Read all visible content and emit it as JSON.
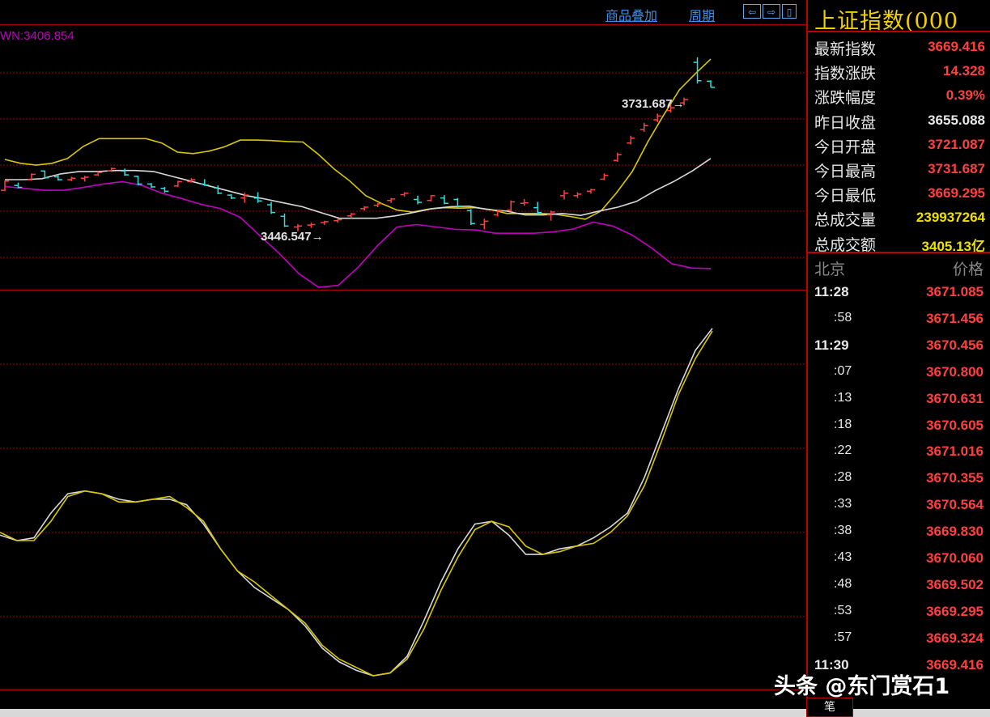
{
  "toolbar": {
    "overlay_label": "商品叠加",
    "period_label": "周期",
    "nav": [
      "⇦",
      "⇨",
      "▯"
    ]
  },
  "chart": {
    "bollinger_dn_label": "WN:3406.854",
    "high_annotation": "3731.687",
    "low_annotation": "3446.547",
    "colors": {
      "up": "#ff4040",
      "down": "#30e0e0",
      "upper_band": "#d8c800",
      "mid_band": "#d8d8d8",
      "lower_band": "#c000c0",
      "grid": "#a00000"
    }
  },
  "chart_data": [
    {
      "type": "candlestick",
      "candles": [
        [
          3456.0,
          3476.0,
          3454.0,
          3475.0
        ],
        [
          3466.0,
          3472.0,
          3460.0,
          3462.0
        ],
        [
          3478.0,
          3491.0,
          3476.0,
          3489.0
        ],
        [
          3496.0,
          3497.0,
          3480.0,
          3482.0
        ],
        [
          3484.0,
          3489.0,
          3476.0,
          3478.0
        ],
        [
          3478.0,
          3484.0,
          3475.0,
          3481.0
        ],
        [
          3481.0,
          3486.0,
          3474.0,
          3483.0
        ],
        [
          3488.0,
          3495.0,
          3486.0,
          3493.0
        ],
        [
          3496.0,
          3503.0,
          3494.0,
          3501.0
        ],
        [
          3496.0,
          3501.0,
          3486.0,
          3488.0
        ],
        [
          3485.0,
          3486.0,
          3466.0,
          3469.0
        ],
        [
          3469.0,
          3471.0,
          3461.0,
          3463.0
        ],
        [
          3460.0,
          3463.0,
          3451.0,
          3454.0
        ],
        [
          3465.0,
          3476.0,
          3463.0,
          3474.0
        ],
        [
          3474.0,
          3481.0,
          3472.0,
          3478.0
        ],
        [
          3469.0,
          3479.0,
          3465.0,
          3467.0
        ],
        [
          3461.0,
          3466.0,
          3448.0,
          3450.0
        ],
        [
          3446.0,
          3448.0,
          3438.0,
          3440.0
        ],
        [
          3440.0,
          3451.0,
          3430.0,
          3446.0
        ],
        [
          3440.0,
          3452.0,
          3430.0,
          3434.0
        ],
        [
          3426.0,
          3432.0,
          3407.0,
          3410.0
        ],
        [
          3402.0,
          3408.0,
          3380.0,
          3382.0
        ],
        [
          3380.0,
          3386.0,
          3371.0,
          3382.0
        ],
        [
          3384.0,
          3389.0,
          3378.0,
          3385.0
        ],
        [
          3389.0,
          3393.0,
          3384.0,
          3391.0
        ],
        [
          3393.0,
          3397.0,
          3389.0,
          3395.0
        ],
        [
          3403.0,
          3409.0,
          3398.0,
          3407.0
        ],
        [
          3418.0,
          3423.0,
          3414.0,
          3421.0
        ],
        [
          3425.0,
          3430.0,
          3421.0,
          3428.0
        ],
        [
          3435.0,
          3440.0,
          3430.0,
          3438.0
        ],
        [
          3447.0,
          3452.0,
          3443.0,
          3450.0
        ],
        [
          3437.0,
          3445.0,
          3427.0,
          3431.0
        ],
        [
          3435.0,
          3446.0,
          3433.0,
          3445.0
        ],
        [
          3440.0,
          3446.0,
          3427.0,
          3429.0
        ],
        [
          3437.0,
          3440.0,
          3420.0,
          3423.0
        ],
        [
          3414.0,
          3417.0,
          3384.0,
          3387.0
        ],
        [
          3385.0,
          3397.0,
          3375.0,
          3392.0
        ],
        [
          3405.0,
          3415.0,
          3402.0,
          3413.0
        ],
        [
          3415.0,
          3435.0,
          3412.0,
          3432.0
        ],
        [
          3429.0,
          3438.0,
          3424.0,
          3430.0
        ],
        [
          3420.0,
          3432.0,
          3405.0,
          3410.0
        ],
        [
          3405.0,
          3414.0,
          3393.0,
          3411.0
        ],
        [
          3445.0,
          3456.0,
          3437.0,
          3450.0
        ],
        [
          3445.0,
          3452.0,
          3440.0,
          3448.0
        ],
        [
          3454.0,
          3459.0,
          3449.0,
          3457.0
        ],
        [
          3479.0,
          3491.0,
          3477.0,
          3487.0
        ],
        [
          3518.0,
          3534.0,
          3515.0,
          3530.0
        ],
        [
          3554.0,
          3569.0,
          3551.0,
          3564.0
        ],
        [
          3582.0,
          3596.0,
          3577.0,
          3590.0
        ],
        [
          3602.0,
          3615.0,
          3597.0,
          3610.0
        ],
        [
          3621.0,
          3633.0,
          3617.0,
          3627.0
        ],
        [
          3637.0,
          3648.0,
          3632.0,
          3644.0
        ],
        [
          3721.087,
          3731.687,
          3677.0,
          3683.0
        ],
        [
          3682.0,
          3684.0,
          3669.295,
          3669.416
        ]
      ],
      "boll_upper": [
        3520,
        3512,
        3508,
        3512,
        3522,
        3547,
        3563,
        3563,
        3563,
        3563,
        3554,
        3535,
        3532,
        3537,
        3546,
        3560,
        3560,
        3559,
        3557,
        3556,
        3530,
        3500,
        3475,
        3445,
        3429,
        3415,
        3411,
        3417,
        3420,
        3419,
        3420,
        3416,
        3408,
        3408,
        3408,
        3407,
        3402,
        3396,
        3413,
        3451,
        3495,
        3557,
        3612,
        3664,
        3697,
        3728
      ],
      "boll_mid": [
        3478,
        3478,
        3480,
        3490,
        3495,
        3495,
        3497,
        3497,
        3495,
        3485,
        3475,
        3465,
        3455,
        3445,
        3438,
        3430,
        3422,
        3410,
        3398,
        3398,
        3398,
        3403,
        3410,
        3418,
        3422,
        3423,
        3416,
        3413,
        3405,
        3405,
        3408,
        3404,
        3413,
        3421,
        3433,
        3455,
        3474,
        3496,
        3522
      ],
      "boll_lower": [
        3464,
        3460,
        3456,
        3456,
        3462,
        3469,
        3474,
        3466,
        3450,
        3439,
        3427,
        3418,
        3400,
        3362,
        3325,
        3283,
        3255,
        3259,
        3296,
        3341,
        3380,
        3385,
        3380,
        3375,
        3374,
        3367,
        3367,
        3367,
        3370,
        3376,
        3390,
        3382,
        3363,
        3336,
        3304,
        3295,
        3294
      ],
      "ylim": [
        3250,
        3800
      ]
    },
    {
      "type": "line",
      "series": [
        {
          "values": [
            0.51,
            0.49,
            0.5,
            0.59,
            0.66,
            0.67,
            0.66,
            0.64,
            0.63,
            0.64,
            0.64,
            0.62,
            0.55,
            0.46,
            0.38,
            0.32,
            0.28,
            0.24,
            0.18,
            0.1,
            0.05,
            0.02,
            0.0,
            0.01,
            0.07,
            0.2,
            0.34,
            0.46,
            0.55,
            0.56,
            0.51,
            0.44,
            0.44,
            0.46,
            0.47,
            0.5,
            0.54,
            0.59,
            0.72,
            0.88,
            1.04,
            1.18,
            1.26
          ]
        },
        {
          "values": [
            0.52,
            0.49,
            0.49,
            0.56,
            0.65,
            0.67,
            0.66,
            0.63,
            0.63,
            0.64,
            0.65,
            0.61,
            0.56,
            0.46,
            0.38,
            0.34,
            0.29,
            0.24,
            0.19,
            0.11,
            0.06,
            0.03,
            0.0,
            0.01,
            0.06,
            0.17,
            0.31,
            0.43,
            0.53,
            0.56,
            0.54,
            0.47,
            0.44,
            0.45,
            0.47,
            0.48,
            0.52,
            0.58,
            0.69,
            0.85,
            1.02,
            1.15,
            1.25
          ]
        }
      ],
      "ylim": [
        -0.05,
        1.4
      ]
    }
  ],
  "panel": {
    "title": "上证指数(000",
    "quotes": [
      {
        "label": "最新指数",
        "value": "3669.416",
        "color": "#ff4040"
      },
      {
        "label": "指数涨跌",
        "value": "14.328",
        "color": "#ff4040"
      },
      {
        "label": "涨跌幅度",
        "value": "0.39%",
        "color": "#ff4040"
      },
      {
        "label": "昨日收盘",
        "value": "3655.088",
        "color": "#e8e8e8"
      },
      {
        "label": "今日开盘",
        "value": "3721.087",
        "color": "#ff4040"
      },
      {
        "label": "今日最高",
        "value": "3731.687",
        "color": "#ff4040"
      },
      {
        "label": "今日最低",
        "value": "3669.295",
        "color": "#ff4040"
      },
      {
        "label": "总成交量",
        "value": "239937264",
        "color": "#f0e000"
      },
      {
        "label": "总成交额",
        "value": "3405.13亿",
        "color": "#f0e000"
      }
    ],
    "ticks_header": {
      "left": "北京",
      "right": "价格"
    },
    "ticks": [
      {
        "time": "11:28",
        "price": "3671.085",
        "full": true
      },
      {
        "time": ":58",
        "price": "3671.456",
        "full": false
      },
      {
        "time": "11:29",
        "price": "3670.456",
        "full": true
      },
      {
        "time": ":07",
        "price": "3670.800",
        "full": false
      },
      {
        "time": ":13",
        "price": "3670.631",
        "full": false
      },
      {
        "time": ":18",
        "price": "3670.605",
        "full": false
      },
      {
        "time": ":22",
        "price": "3671.016",
        "full": false
      },
      {
        "time": ":28",
        "price": "3670.355",
        "full": false
      },
      {
        "time": ":33",
        "price": "3670.564",
        "full": false
      },
      {
        "time": ":38",
        "price": "3669.830",
        "full": false
      },
      {
        "time": ":43",
        "price": "3670.060",
        "full": false
      },
      {
        "time": ":48",
        "price": "3669.502",
        "full": false
      },
      {
        "time": ":53",
        "price": "3669.295",
        "full": false
      },
      {
        "time": ":57",
        "price": "3669.324",
        "full": false
      },
      {
        "time": "11:30",
        "price": "3669.416",
        "full": true
      }
    ],
    "bottom_tab": "笔"
  },
  "watermark": "头条 @东门赏石1"
}
